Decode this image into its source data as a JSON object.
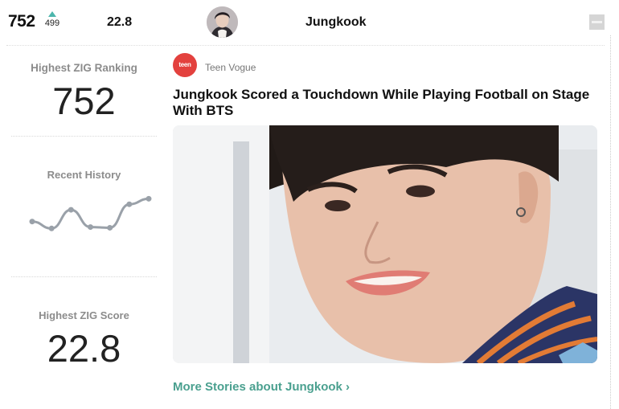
{
  "header": {
    "ranking": "752",
    "delta": "499",
    "score": "22.8",
    "name": "Jungkook",
    "accent_color": "#4db6ac"
  },
  "sidebar": {
    "ranking_label": "Highest ZIG Ranking",
    "ranking_value": "752",
    "history_label": "Recent History",
    "history_values": [
      0.55,
      0.45,
      0.72,
      0.47,
      0.46,
      0.8,
      0.88
    ],
    "score_label": "Highest ZIG Score",
    "score_value": "22.8"
  },
  "article": {
    "source": "Teen Vogue",
    "source_logo_text": "teen vogue",
    "headline": "Jungkook Scored a Touchdown While Playing Football on Stage With BTS",
    "more_link": "More Stories about Jungkook ›"
  },
  "icons": {
    "trend": "triangle-up-icon",
    "minimize": "minimize-icon"
  }
}
